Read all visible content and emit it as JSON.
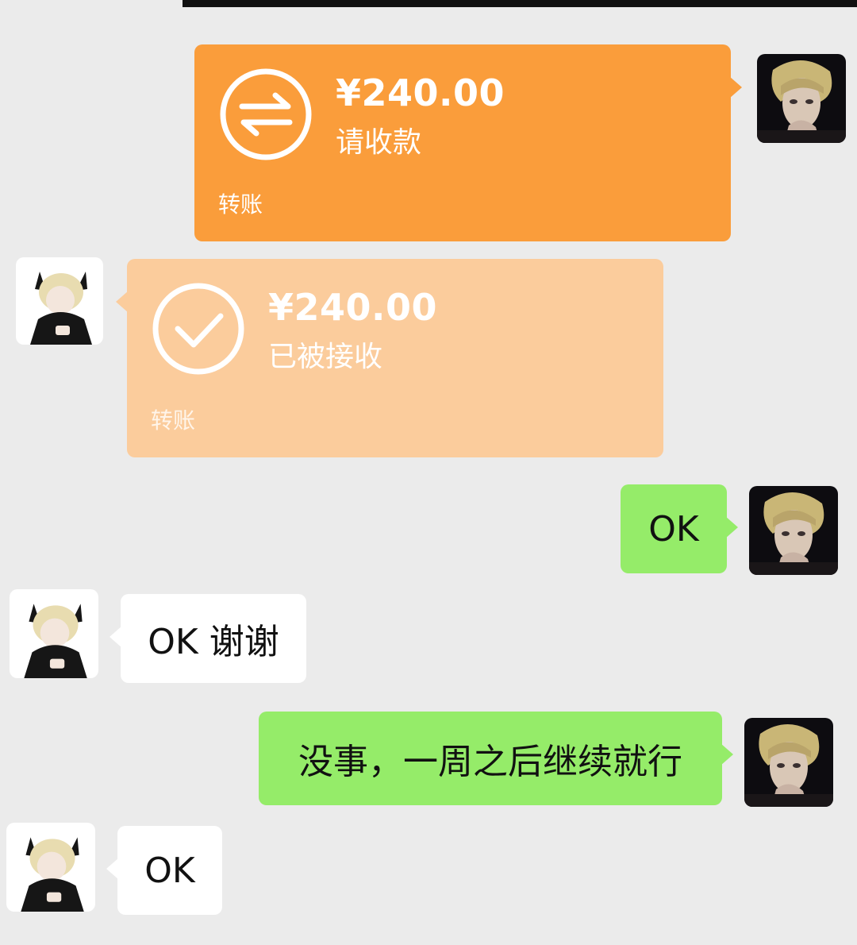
{
  "messages": [
    {
      "type": "transfer",
      "side": "right",
      "amount": "¥240.00",
      "status": "请收款",
      "label": "转账"
    },
    {
      "type": "transfer",
      "side": "left",
      "amount": "¥240.00",
      "status": "已被接收",
      "label": "转账"
    },
    {
      "type": "text",
      "side": "right",
      "text": "OK"
    },
    {
      "type": "text",
      "side": "left",
      "text": "OK 谢谢"
    },
    {
      "type": "text",
      "side": "right",
      "text": "没事，一周之后继续就行"
    },
    {
      "type": "text",
      "side": "left",
      "text": "OK"
    }
  ],
  "colors": {
    "background": "#ebebeb",
    "transfer_pending": "#fa9d3b",
    "transfer_accepted": "#fbcc9c",
    "sent_bubble": "#95ec69",
    "received_bubble": "#ffffff"
  },
  "icons": {
    "transfer_pending": "transfer-arrows-icon",
    "transfer_accepted": "checkmark-icon"
  }
}
